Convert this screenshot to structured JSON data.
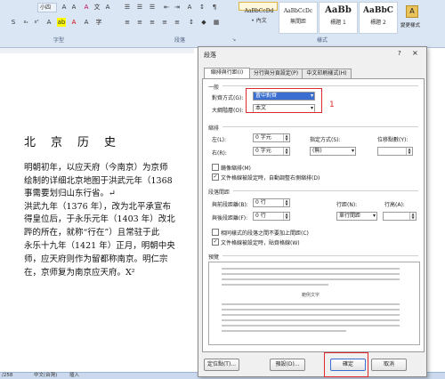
{
  "ribbon": {
    "font_size_value": "小四",
    "font_group_label": "字型",
    "paragraph_group_label": "段落",
    "styles_group_label": "樣式",
    "styles": [
      {
        "sample": "AaBbCcDd",
        "name": "• 內文"
      },
      {
        "sample": "AaBbCcDc",
        "name": "無間距"
      },
      {
        "sample": "AaBb",
        "name": "標題 1"
      },
      {
        "sample": "AaBbC",
        "name": "標題 2"
      }
    ],
    "change_styles_label": "變更樣式"
  },
  "document": {
    "title": "北　京　历　史",
    "lines": [
      "明朝初年，以应天府（今南京）为京师",
      "绘制的详细北京地图于洪武元年（1368",
      "事需要划归山东行省。↵",
      "洪武九年（1376 年），改为北平承宣布",
      "得皇位后，于永乐元年（1403 年）改北",
      "跸的所在，就称“行在”）且常驻于此",
      "永乐十九年（1421 年）正月，明朝中央",
      "师，应天府则作为留都称南京。明仁宗",
      "在，京师复为南京应天府。X²"
    ]
  },
  "status_bar": {
    "left": "/258",
    "lang": "中文(台灣)",
    "mode": "插入"
  },
  "dialog": {
    "title": "段落",
    "help": "?",
    "close": "×",
    "tabs": [
      "縮排與行距(I)",
      "分行與分頁設定(P)",
      "中文印刷樣式(H)"
    ],
    "general": {
      "section": "一般",
      "alignment_label": "對齊方式(G):",
      "alignment_value": "置中對齊",
      "outline_label": "大綱階層(O):",
      "outline_value": "本文"
    },
    "indent": {
      "section": "縮排",
      "left_label": "左(L):",
      "left_value": "0 字元",
      "right_label": "右(R):",
      "right_value": "0 字元",
      "special_label": "指定方式(S):",
      "special_value": "(無)",
      "by_label": "位移點數(Y):",
      "mirror_label": "鏡像縮排(M)",
      "auto_adjust_label": "文件格線被設定時，自動調整右側縮排(D)"
    },
    "spacing": {
      "section": "段落間距",
      "before_label": "與前段距離(B):",
      "before_value": "0 行",
      "after_label": "與後段距離(F):",
      "after_value": "0 行",
      "line_spacing_label": "行距(N):",
      "line_spacing_value": "單行間距",
      "at_label": "行高(A):",
      "same_style_label": "相同樣式的段落之間不要加上間距(C)",
      "snap_grid_label": "文件格線被設定時，貼齊格線(W)"
    },
    "preview": {
      "section": "預覽",
      "sample_text": "範例文字"
    },
    "buttons": {
      "tabs": "定位點(T)...",
      "default": "預設(D)...",
      "ok": "確定",
      "cancel": "取消"
    },
    "annotation_number": "1"
  },
  "colors": {
    "highlight_red": "#e0292c",
    "ribbon_bg": "#dbe6f4"
  }
}
